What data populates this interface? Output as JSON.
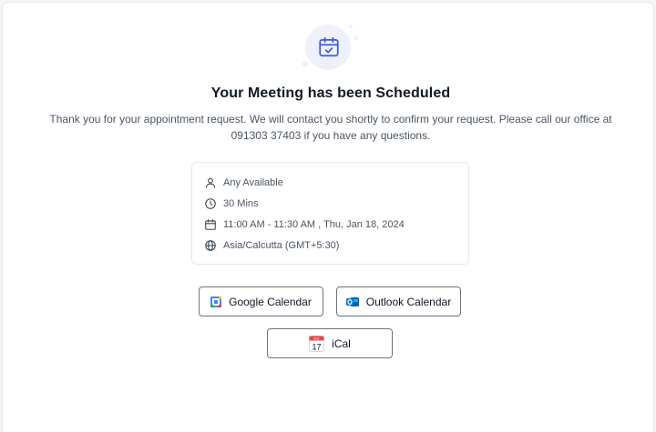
{
  "confirmation": {
    "title": "Your Meeting has been Scheduled",
    "message": "Thank you for your appointment request. We will contact you shortly to confirm your request. Please call our office at 091303 37403 if you have any questions."
  },
  "details": {
    "staff": "Any Available",
    "duration": "30 Mins",
    "datetime": "11:00 AM - 11:30 AM , Thu, Jan 18, 2024",
    "timezone": "Asia/Calcutta (GMT+5:30)"
  },
  "buttons": {
    "google": "Google Calendar",
    "outlook": "Outlook Calendar",
    "ical": "iCal",
    "ical_icon_month": "JUL",
    "ical_icon_day": "17"
  },
  "icons": {
    "hero": "calendar-check-icon",
    "staff": "person-icon",
    "duration": "clock-icon",
    "datetime": "calendar-icon",
    "timezone": "globe-icon"
  },
  "colors": {
    "accent": "#3b5bdb",
    "hero_bg": "#eef0fb",
    "text": "#111827",
    "muted": "#4b5563"
  }
}
